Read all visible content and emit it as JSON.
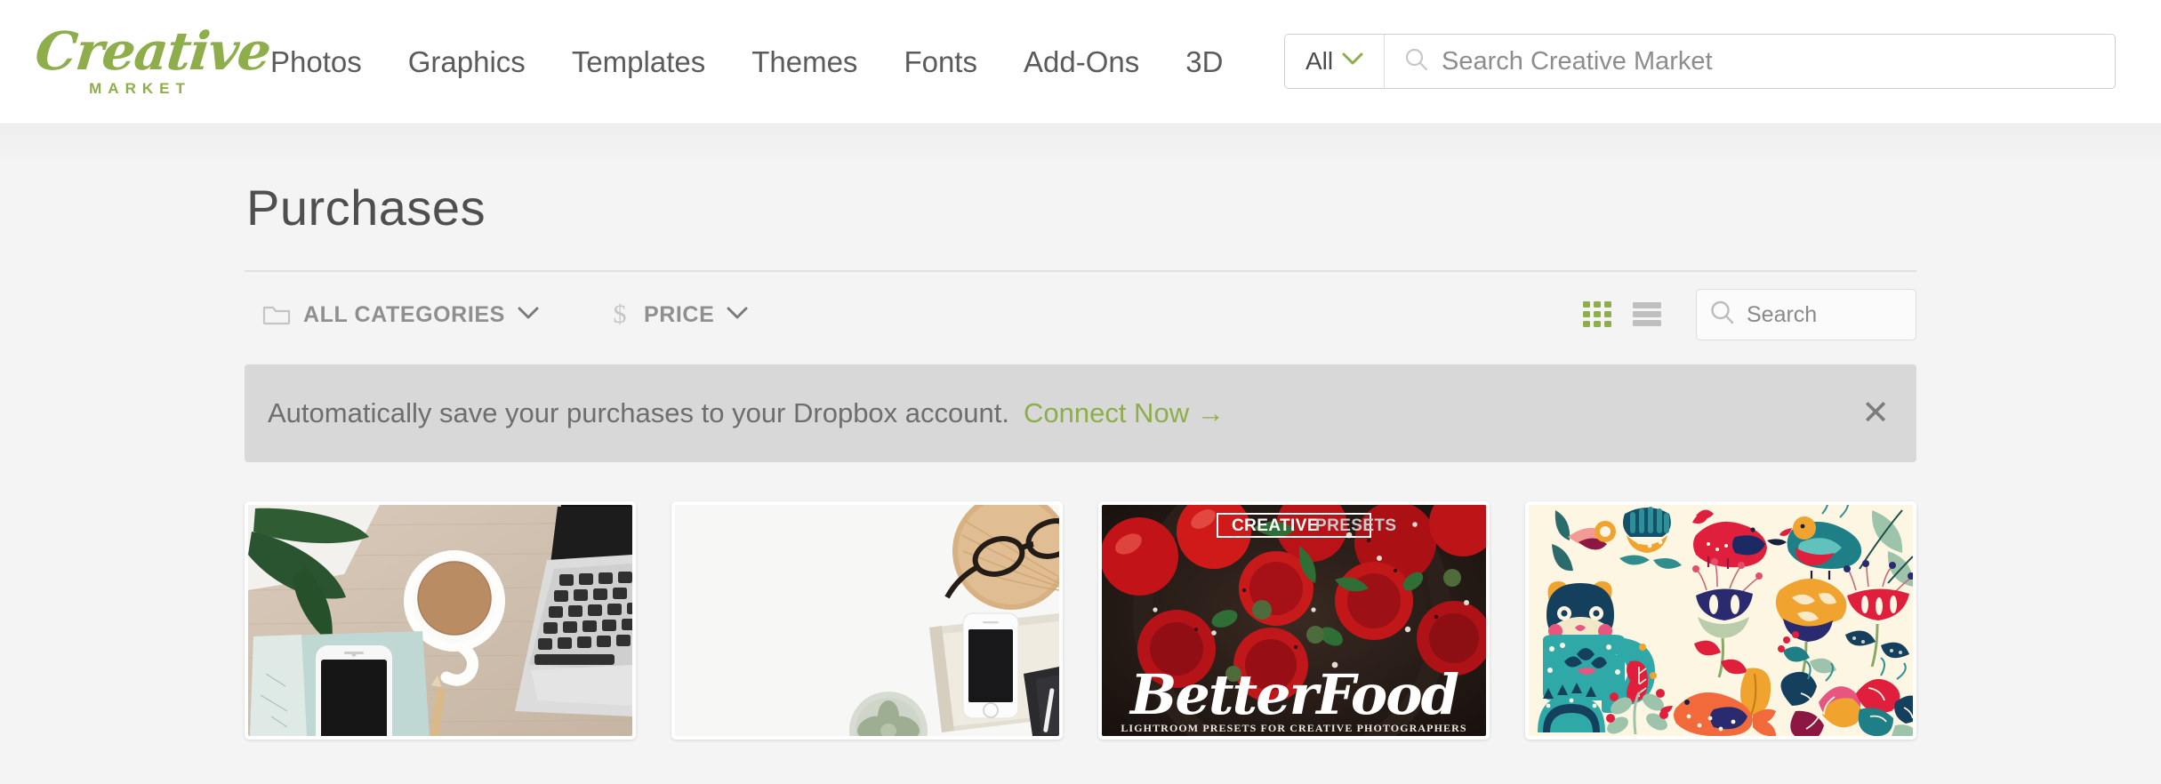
{
  "header": {
    "logo": {
      "word": "Creative",
      "sub": "MARKET",
      "color": "#8ead4b"
    },
    "nav": [
      {
        "label": "Photos"
      },
      {
        "label": "Graphics"
      },
      {
        "label": "Templates"
      },
      {
        "label": "Themes"
      },
      {
        "label": "Fonts"
      },
      {
        "label": "Add-Ons"
      },
      {
        "label": "3D"
      }
    ],
    "search": {
      "scope_label": "All",
      "scope_icon": "chevron-down-icon",
      "search_icon": "search-icon",
      "placeholder": "Search Creative Market",
      "value": ""
    }
  },
  "main": {
    "page_title": "Purchases",
    "filters": [
      {
        "icon": "folder-icon",
        "label": "ALL CATEGORIES",
        "caret": "chevron-down-icon"
      },
      {
        "icon": "dollar-icon",
        "label": "PRICE",
        "caret": "chevron-down-icon"
      }
    ],
    "view_toggle": {
      "grid": {
        "icon": "grid-view-icon",
        "active": true,
        "color": "#8ead4b"
      },
      "list": {
        "icon": "list-view-icon",
        "active": false,
        "color": "#bfbfbf"
      }
    },
    "list_search": {
      "icon": "search-icon",
      "placeholder": "Search",
      "value": ""
    },
    "banner": {
      "message": "Automatically save your purchases to your Dropbox account.",
      "link_label": "Connect Now →",
      "link_color": "#8ead4b",
      "close_icon": "close-icon",
      "close_label": "✕",
      "background": "#d8d8d8"
    },
    "products": [
      {
        "name": "flat-lay-coffee-laptop-phone-photo",
        "kind": "photo",
        "description": "Overhead desk flat lay with green plant leaves, white mug of milky coffee, mint notebook, white smartphone, pencil and silver laptop on a light wood table"
      },
      {
        "name": "minimal-white-desk-glasses-phone-photo",
        "kind": "photo",
        "description": "Minimal white desk flat lay with wooden tray holding eyeglasses, white smartphone on cream books, dark notebook with pen and a small succulent"
      },
      {
        "name": "betterfood-lightroom-presets",
        "kind": "product-cover",
        "badge_primary": "CREATIVE",
        "badge_secondary": "PRESETS",
        "title": "BetterFood",
        "subtitle": "LIGHTROOM PRESETS FOR CREATIVE PHOTOGRAPHERS",
        "description": "Dark moody food photo of halved red cherry tomatoes with capers and sea salt on a dark pan"
      },
      {
        "name": "folk-art-birds-flowers-clipart",
        "kind": "illustration",
        "description": "Scandinavian folk art clipart set on cream background — teal cat, red and teal birds, butterflies and stylised navy, orange and red flowers with leaves"
      }
    ]
  }
}
